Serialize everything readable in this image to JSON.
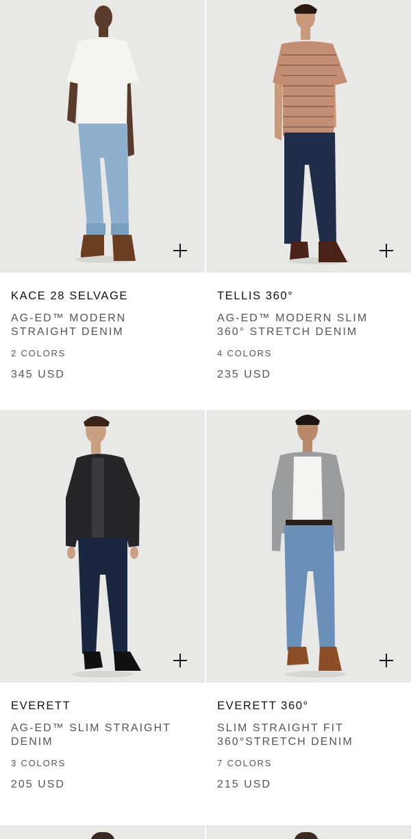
{
  "products": [
    {
      "name": "KACE 28 SELVAGE",
      "description": "AG-ED™ MODERN STRAIGHT DENIM",
      "colors": "2 COLORS",
      "price": "345 USD",
      "add_icon": "plus-icon"
    },
    {
      "name": "TELLIS 360°",
      "description": "AG-ED™ MODERN SLIM 360° STRETCH DENIM",
      "colors": "4 COLORS",
      "price": "235 USD",
      "add_icon": "plus-icon"
    },
    {
      "name": "EVERETT",
      "description": "AG-ED™ SLIM STRAIGHT DENIM",
      "colors": "3 COLORS",
      "price": "205 USD",
      "add_icon": "plus-icon"
    },
    {
      "name": "EVERETT 360°",
      "description": "SLIM STRAIGHT FIT 360°STRETCH DENIM",
      "colors": "7 COLORS",
      "price": "215 USD",
      "add_icon": "plus-icon"
    }
  ],
  "colors": {
    "photo_background": "#e8e8e6",
    "name_text": "#111111",
    "meta_text": "#555555"
  }
}
